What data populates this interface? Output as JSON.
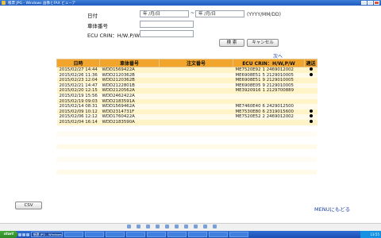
{
  "window": {
    "title": "帳票 JPG - Windows 画像とFAX ビューア"
  },
  "search_form": {
    "date_label": "日付",
    "date_from": "年  /月/日",
    "date_to": "年  /月/日",
    "date_separator": "~",
    "date_format_hint": "(YYYY/MM/DD)",
    "vehicle_label": "車体番号",
    "vehicle_value": "",
    "ecu_label": "ECU CRIN：H/W,P/W",
    "ecu_value": "",
    "search_button": "検 索",
    "cancel_button": "キャンセル"
  },
  "pagination": {
    "next_label": "次へ"
  },
  "table": {
    "headers": [
      "日時",
      "車体番号",
      "注文番号",
      "ECU CRIN：H/W,P/W",
      "適送"
    ],
    "rows": [
      {
        "datetime": "2015/02/27 14:44",
        "vehicle": "WDD1569422A",
        "order": "",
        "ecu": "ME7520E92",
        "hwpw": "1 2469012002",
        "sent": true
      },
      {
        "datetime": "2015/02/26 11:36",
        "vehicle": "WDD2120362B",
        "order": "",
        "ecu": "ME6908E51",
        "hwpw": "5 2129010005",
        "sent": true
      },
      {
        "datetime": "2015/02/23 12:04",
        "vehicle": "WDD2120362B",
        "order": "",
        "ecu": "ME6908E51",
        "hwpw": "9 2129010005",
        "sent": false
      },
      {
        "datetime": "2015/02/21 14:47",
        "vehicle": "WDD2122801B",
        "order": "",
        "ecu": "ME6908E05",
        "hwpw": "9 2129010005",
        "sent": false
      },
      {
        "datetime": "2015/02/20 12:15",
        "vehicle": "WDD2120562A",
        "order": "",
        "ecu": "ME3920916",
        "hwpw": "1 2129700889",
        "sent": false
      },
      {
        "datetime": "2015/02/19 15:56",
        "vehicle": "WDD2462422A",
        "order": "",
        "ecu": "",
        "hwpw": "",
        "sent": false
      },
      {
        "datetime": "2015/02/19 09:03",
        "vehicle": "WDD2183591A",
        "order": "",
        "ecu": "",
        "hwpw": "",
        "sent": false
      },
      {
        "datetime": "2015/02/14 08:31",
        "vehicle": "WDD1569462A",
        "order": "",
        "ecu": "ME7460E40",
        "hwpw": "6 2429012500",
        "sent": false
      },
      {
        "datetime": "2015/02/09 10:12",
        "vehicle": "WDD2314731F",
        "order": "",
        "ecu": "ME7530E80",
        "hwpw": "6 2319015600",
        "sent": true
      },
      {
        "datetime": "2015/02/06 12:12",
        "vehicle": "WDD1760422A",
        "order": "",
        "ecu": "ME7520E52",
        "hwpw": "2 2469012002",
        "sent": true
      },
      {
        "datetime": "2015/02/04 16:14",
        "vehicle": "WDD2183590A",
        "order": "",
        "ecu": "",
        "hwpw": "",
        "sent": true
      }
    ]
  },
  "footer": {
    "csv_button": "CSV",
    "menu_link": "MENUにもどる"
  },
  "taskbar": {
    "start_label": "start",
    "tasks": [
      "帳票 JPG - Windows",
      "",
      "",
      "",
      "",
      "",
      "",
      "",
      "",
      ""
    ],
    "clock": "13:55"
  },
  "colors": {
    "header_bg": "#f2a52d",
    "row_odd": "#fff3c8",
    "row_even": "#fffbe8",
    "link": "#1a3fa8"
  }
}
